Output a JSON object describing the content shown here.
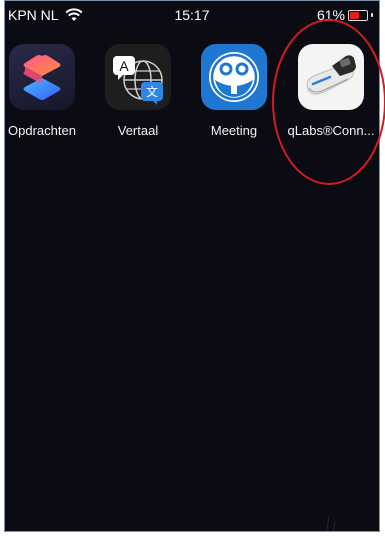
{
  "status_bar": {
    "carrier": "KPN NL",
    "time": "15:17",
    "battery_percent": "61%",
    "battery_level": 0.61,
    "battery_color": "#e02020"
  },
  "apps": [
    {
      "label": "Opdrachten",
      "icon": "shortcuts-icon"
    },
    {
      "label": "Vertaal",
      "icon": "translate-icon"
    },
    {
      "label": "Meeting",
      "icon": "meeting-icon"
    },
    {
      "label": "qLabs®Conn...",
      "icon": "qlabs-device-icon"
    }
  ],
  "highlight_color": "#d61a22"
}
